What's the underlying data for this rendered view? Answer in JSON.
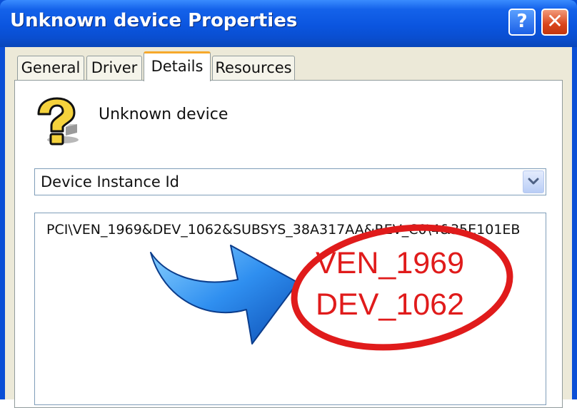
{
  "window": {
    "title": "Unknown device Properties"
  },
  "titlebar": {
    "help_label": "?",
    "close_label": "✕"
  },
  "tabs": [
    {
      "label": "General",
      "selected": false
    },
    {
      "label": "Driver",
      "selected": false
    },
    {
      "label": "Details",
      "selected": true
    },
    {
      "label": "Resources",
      "selected": false
    }
  ],
  "device": {
    "name": "Unknown device",
    "icon": "unknown-device-question-icon"
  },
  "property_select": {
    "selected": "Device Instance Id",
    "icon": "chevron-down-icon"
  },
  "values": [
    "PCI\\VEN_1969&DEV_1062&SUBSYS_38A317AA&REV_C0\\4&35E101EB"
  ],
  "annotation": {
    "callout_lines": [
      "VEN_1969",
      "DEV_1062"
    ],
    "colors": {
      "circle": "#e01b1b",
      "arrow": "#2f8ff0"
    }
  },
  "colors": {
    "titlebar": "#0b55df",
    "dialog_bg": "#ece9d8",
    "tab_active_accent": "#f6a82b"
  }
}
